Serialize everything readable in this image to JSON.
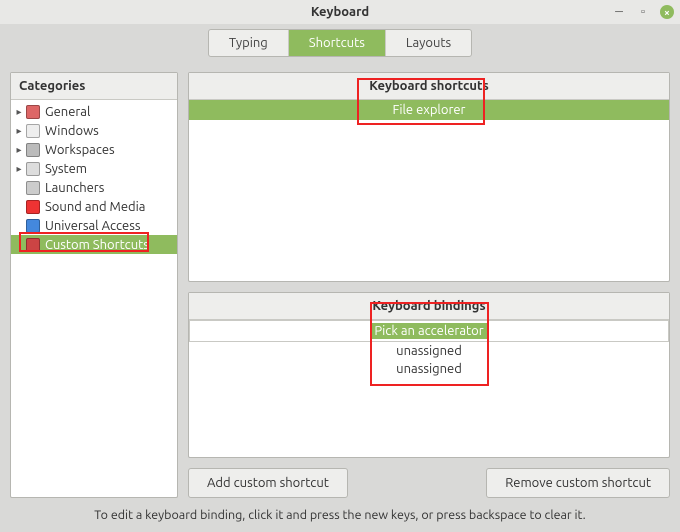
{
  "window": {
    "title": "Keyboard"
  },
  "tabs": {
    "typing": "Typing",
    "shortcuts": "Shortcuts",
    "layouts": "Layouts"
  },
  "categories": {
    "header": "Categories",
    "items": {
      "general": "General",
      "windows": "Windows",
      "workspaces": "Workspaces",
      "system": "System",
      "launchers": "Launchers",
      "sound": "Sound and Media",
      "universal": "Universal Access",
      "custom": "Custom Shortcuts"
    }
  },
  "shortcuts": {
    "header": "Keyboard shortcuts",
    "rows": {
      "file_explorer": "File explorer"
    }
  },
  "bindings": {
    "header": "Keyboard bindings",
    "rows": {
      "pick": "Pick an accelerator",
      "u1": "unassigned",
      "u2": "unassigned"
    }
  },
  "buttons": {
    "add": "Add custom shortcut",
    "remove": "Remove custom shortcut"
  },
  "hint": "To edit a keyboard binding, click it and press the new keys, or press backspace to clear it."
}
